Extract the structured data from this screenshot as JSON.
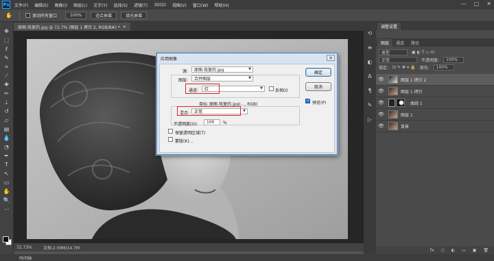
{
  "app": {
    "logo": "Ps"
  },
  "menubar": {
    "items": [
      "文件(F)",
      "编辑(E)",
      "图像(I)",
      "图层(L)",
      "文字(Y)",
      "选择(S)",
      "滤镜(T)",
      "3D(D)",
      "视图(V)",
      "窗口(W)",
      "帮助(H)"
    ]
  },
  "window_controls": {
    "minimize": "—",
    "restore": "□",
    "close": "✕"
  },
  "options_bar": {
    "scroll_all": "滚动所有窗口",
    "zoom": "100%",
    "fit_screen": "适合屏幕",
    "fill_screen": "填充屏幕"
  },
  "document": {
    "tab_title": "原图-恢复的.jpg @ 72.7% (图层 1 拷贝 2, RGB/8#) *",
    "close": "×"
  },
  "status": {
    "zoom": "72.73%",
    "doc_info": "文档:2.09M/14.7M"
  },
  "timeline": {
    "label": "时间轴"
  },
  "panel": {
    "top_tab": "调整设置",
    "tabs": [
      "图层",
      "通道",
      "路径"
    ],
    "kind_label": "类型",
    "blend_mode": "正常",
    "opacity_label": "不透明度:",
    "opacity_value": "100%",
    "lock_label": "锁定:",
    "fill_label": "填充:",
    "fill_value": "100%",
    "layers": [
      {
        "name": "图层 1 拷贝 2",
        "selected": true
      },
      {
        "name": "图层 1 拷贝",
        "selected": false
      },
      {
        "name": "曲线 1",
        "selected": false
      },
      {
        "name": "图层 1",
        "selected": false
      },
      {
        "name": "背景",
        "selected": false
      }
    ],
    "bottom_icons": [
      "fx",
      "○",
      "◐",
      "▭",
      "▣",
      "🗑"
    ]
  },
  "dialog": {
    "title": "应用图像",
    "source_label": "源:",
    "source_value": "原图-恢复的.jpg",
    "layer_label": "图层:",
    "layer_value": "合并图层",
    "channel_label": "通道:",
    "channel_value": "红",
    "invert_label": "反相(I)",
    "target_label": "目标:",
    "target_value": "原图-恢复的.jpg(..., RGB)",
    "blending_label": "混合:",
    "blending_value": "正常",
    "opacity_label": "不透明度(O):",
    "opacity_value": "100",
    "percent": "%",
    "preserve_label": "保留透明区域(T)",
    "mask_label": "蒙版(K)...",
    "ok_label": "确定",
    "cancel_label": "取消",
    "preview_label": "预览(P)",
    "preview_checked": true
  }
}
